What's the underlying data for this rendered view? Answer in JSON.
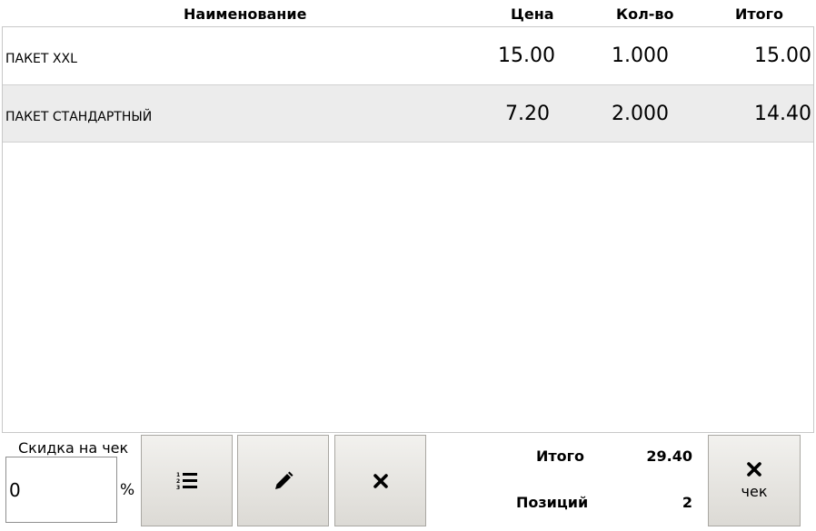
{
  "header": {
    "name": "Наименование",
    "price": "Цена",
    "qty": "Кол-во",
    "total": "Итого"
  },
  "rows": [
    {
      "name": "ПАКЕТ XXL",
      "price": "15.00",
      "qty": "1.000",
      "total": "15.00"
    },
    {
      "name": "ПАКЕТ СТАНДАРТНЫЙ",
      "price": "7.20",
      "qty": "2.000",
      "total": "14.40"
    }
  ],
  "discount": {
    "label": "Скидка на чек",
    "value": "0",
    "percent": "%"
  },
  "toolbar": {
    "list_icon": "numbered-list-icon",
    "edit_icon": "pencil-icon",
    "delete_icon": "close-icon"
  },
  "summary": {
    "total_label": "Итого",
    "total_value": "29.40",
    "positions_label": "Позиций",
    "positions_value": "2"
  },
  "cancel_receipt": {
    "icon": "close-icon",
    "label": "чек"
  }
}
